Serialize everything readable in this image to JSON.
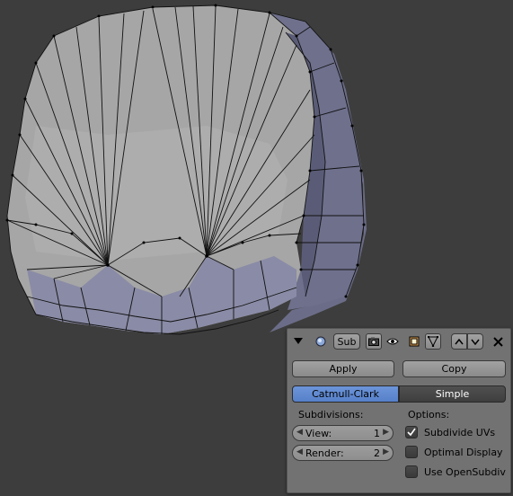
{
  "modifier": {
    "name_field": "Sub",
    "apply_label": "Apply",
    "copy_label": "Copy",
    "modes": [
      "Catmull-Clark",
      "Simple"
    ],
    "active_mode": "Catmull-Clark",
    "subdivisions_label": "Subdivisions:",
    "view_label": "View:",
    "view_value": "1",
    "render_label": "Render:",
    "render_value": "2",
    "options_label": "Options:",
    "options": [
      {
        "label": "Subdivide UVs",
        "checked": true
      },
      {
        "label": "Optimal Display",
        "checked": false
      },
      {
        "label": "Use OpenSubdiv",
        "checked": false
      }
    ]
  },
  "colors": {
    "viewport_bg": "#3d3d3d",
    "panel_bg": "#727272",
    "active_blue": "#5680c9",
    "mesh_grey": "#a8a8a8",
    "mesh_side": "#6b6d88"
  }
}
